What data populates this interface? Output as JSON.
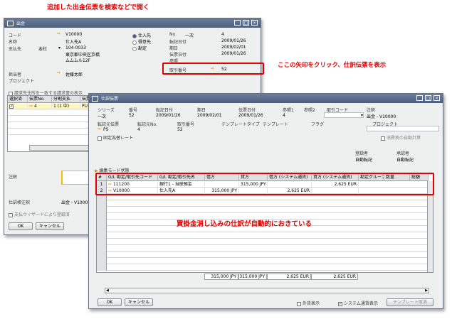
{
  "annotations": {
    "top": "追加した出金伝票を検索などで開く",
    "right": "ここの矢印をクリック、仕訳伝票を表示",
    "middle": "買掛金消し込みの仕訳が自動的におきている"
  },
  "colors": {
    "annotation": "#e00000",
    "arrow": "#e09000",
    "title_bar": "#566884"
  },
  "payment_window": {
    "title": "出金",
    "labels": {
      "code": "コード",
      "name": "名称",
      "pay_to": "支払先",
      "person": "担当者",
      "project": "プロジェクト"
    },
    "values": {
      "code": "V10000",
      "name": "仕入先A",
      "pay_to_select": "本社",
      "address_line1": "104-0033",
      "address_line2": "東京都中央区京橋",
      "address_line3": "ムムムル12F",
      "person": "佐藤太郎"
    },
    "radios": [
      "仕入先",
      "得意先",
      "勘定"
    ],
    "right_labels": {
      "no": "No.",
      "posting_date": "転記日付",
      "due_date": "期日",
      "doc_date": "伝票日付",
      "ref": "参照",
      "journal_no": "取引番号"
    },
    "right_values": {
      "series": "一次",
      "no": "4",
      "posting_date": "2009/01/26",
      "due_date": "2009/02/01",
      "doc_date": "2009/01/26",
      "journal_no": "52"
    },
    "checkbox_label": "請求先住所を一致する請求書の表示",
    "grid_headers": [
      "選択済",
      "伝票No.",
      "分割支払",
      "伝票"
    ],
    "grid_row": {
      "no": "4",
      "split": "1 (1 中)",
      "type": "PU"
    },
    "remarks_label": "注釈",
    "journal_remarks_label": "仕訳帳注釈",
    "journal_remarks_value": "出金 - V10000",
    "wizard_label": "支払ウィザードにより登録済",
    "ok": "OK",
    "cancel": "キャンセル"
  },
  "journal_window": {
    "title": "仕訳伝票",
    "headers": {
      "series": "シリーズ",
      "number": "番号",
      "posting_date": "転記日付",
      "due_date": "期日",
      "doc_date": "伝票日付",
      "ref1": "参照1",
      "ref2": "参照2",
      "txn_code": "取引コード",
      "remarks": "注釈"
    },
    "header_values": {
      "series": "一次",
      "number": "52",
      "posting_date": "2009/01/26",
      "due_date": "2009/02/01",
      "doc_date": "2009/01/26",
      "ref1": "4",
      "remarks": "出金 - V10000"
    },
    "row2_headers": {
      "orig_doc": "転記元伝票",
      "orig_no": "転記元No.",
      "txn_no": "取引番号",
      "template_type": "テンプレートタイプ",
      "template": "テンプレート",
      "flag": "フラグ",
      "project": "プロジェクト"
    },
    "row2_values": {
      "orig_doc": "PS",
      "orig_no": "4",
      "txn_no": "52"
    },
    "fixed_rate": "固定為替レート",
    "auto_tax": "消費税の自動計算",
    "creator_label": "登録者",
    "approver_label": "承認者",
    "creator_value": "自動転記",
    "approver_value": "自動転記",
    "section_label": "編集モード状態",
    "grid_headers": [
      "#",
      "G/L 勘定/取引先コード",
      "G/L 勘定/取引先名",
      "借方",
      "貸方",
      "借方 (システム通貨)",
      "貸方 (システム通貨)",
      "勘定グループ",
      "数量",
      "総額"
    ],
    "rows": [
      {
        "num": "1",
        "code": "111200",
        "name": "銀行1 - 当座預金",
        "debit": "",
        "credit": "315,000 JPY",
        "debit_sys": "",
        "credit_sys": "2,625 EUR"
      },
      {
        "num": "2",
        "code": "V10000",
        "name": "仕入先A",
        "debit": "315,000 JPY",
        "credit": "",
        "debit_sys": "2,625 EUR",
        "credit_sys": ""
      }
    ],
    "totals": {
      "debit": "315,000 JPY",
      "credit": "315,000 JPY",
      "debit_sys": "2,625 EUR",
      "credit_sys": "2,625 EUR"
    },
    "ok": "OK",
    "cancel": "キャンセル",
    "foreign_display": "外貨表示",
    "system_display": "システム通貨表示",
    "template_cancel": "テンプレート取消"
  }
}
